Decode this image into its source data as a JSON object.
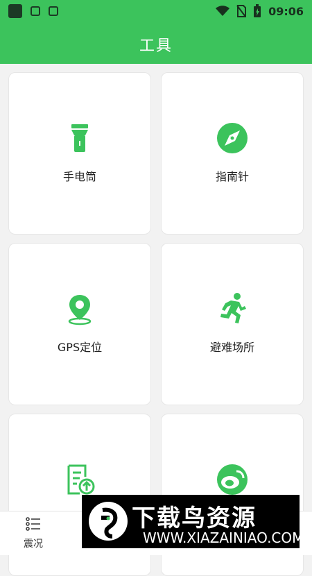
{
  "status_bar": {
    "time": "09:06",
    "icons": [
      "app-square-icon",
      "shield-icon",
      "a-icon",
      "wifi-icon",
      "no-sim-icon",
      "battery-charging-icon"
    ]
  },
  "app_bar": {
    "title": "工具"
  },
  "tools": [
    {
      "label": "手电筒",
      "icon": "flashlight-icon"
    },
    {
      "label": "指南针",
      "icon": "compass-icon"
    },
    {
      "label": "GPS定位",
      "icon": "location-pin-icon"
    },
    {
      "label": "避难场所",
      "icon": "running-person-icon"
    },
    {
      "label": "",
      "icon": "document-upload-icon"
    },
    {
      "label": "",
      "icon": "weibo-icon"
    }
  ],
  "bottom_nav": {
    "items": [
      {
        "label": "震况",
        "icon": "list-icon"
      }
    ]
  },
  "watermark": {
    "title": "下载鸟资源",
    "url": "WWW.XIAZAINIAO.COM"
  },
  "colors": {
    "primary_green": "#3cc35c",
    "background": "#f2f2f2",
    "card": "#ffffff",
    "text": "#222222"
  }
}
